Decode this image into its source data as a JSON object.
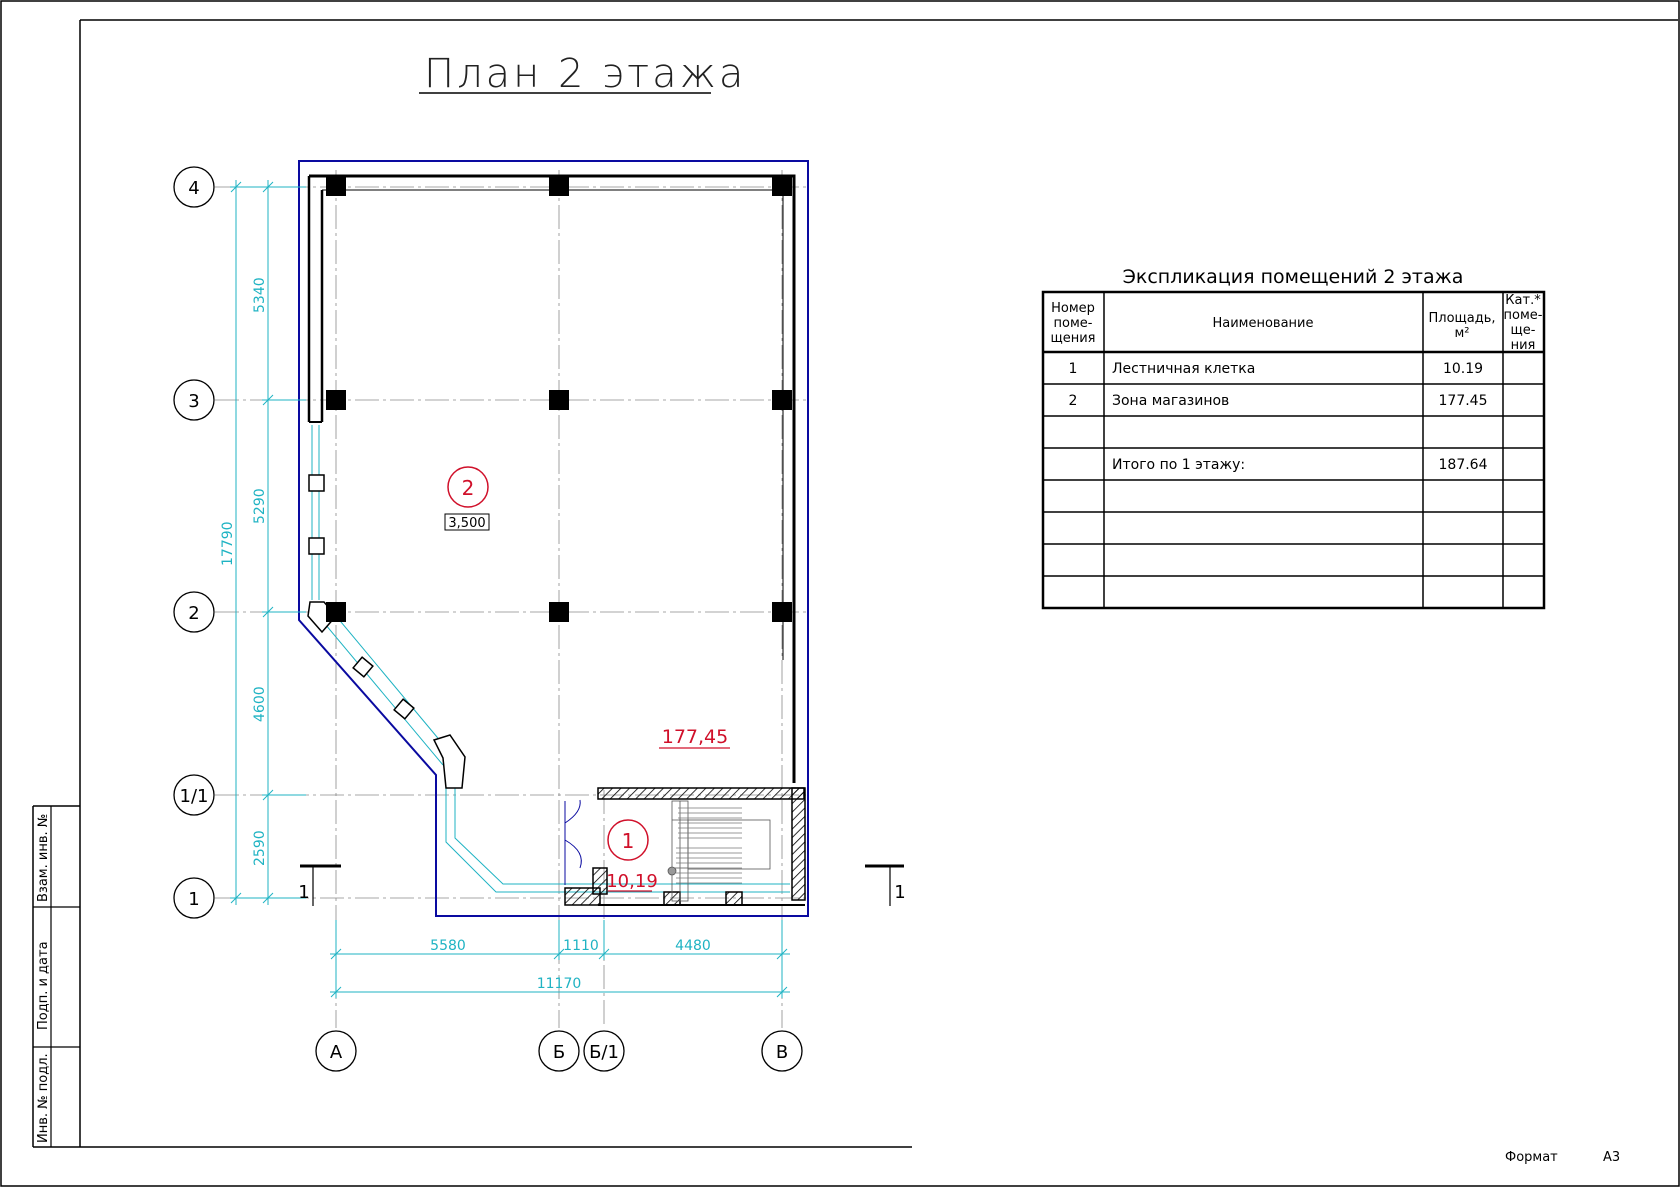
{
  "sheet": {
    "title": "План 2 этажа",
    "format_label": "Формат",
    "format_value": "А3"
  },
  "stamp": {
    "vzam": "Взам. инв. №",
    "podp": "Подп. и дата",
    "inv": "Инв. № подл."
  },
  "plan": {
    "axes_rows": [
      "4",
      "3",
      "2",
      "1/1",
      "1"
    ],
    "axes_cols": [
      "А",
      "Б",
      "Б/1",
      "В"
    ],
    "dims_vertical": [
      "5340",
      "5290",
      "4600",
      "2590"
    ],
    "dim_vertical_total": "17790",
    "dims_horizontal": [
      "5580",
      "1110",
      "4480"
    ],
    "dim_horizontal_total": "11170",
    "section_label": "1",
    "rooms": [
      {
        "number": "1",
        "area": "10,19"
      },
      {
        "number": "2",
        "area": "177,45",
        "level": "3,500"
      }
    ],
    "colors": {
      "line": "#000000",
      "outline": "#0a0aa0",
      "dimension": "#1fb3c3",
      "room_mark": "#d0102a",
      "axis": "#8a8a8a"
    }
  },
  "table": {
    "title": "Экспликация помещений 2 этажа",
    "headers": {
      "num": [
        "Номер",
        "поме-",
        "щения"
      ],
      "name": "Наименование",
      "area": [
        "Площадь,",
        "м²"
      ],
      "cat": [
        "Кат.*",
        "поме-",
        "ще-",
        "ния"
      ]
    },
    "rows": [
      {
        "num": "1",
        "name": "Лестничная клетка",
        "area": "10.19"
      },
      {
        "num": "2",
        "name": "Зона магазинов",
        "area": "177.45"
      },
      {
        "num": "",
        "name": "",
        "area": ""
      },
      {
        "num": "",
        "name": "Итого по 1 этажу:",
        "area": "187.64"
      },
      {
        "num": "",
        "name": "",
        "area": ""
      },
      {
        "num": "",
        "name": "",
        "area": ""
      },
      {
        "num": "",
        "name": "",
        "area": ""
      },
      {
        "num": "",
        "name": "",
        "area": ""
      }
    ]
  }
}
